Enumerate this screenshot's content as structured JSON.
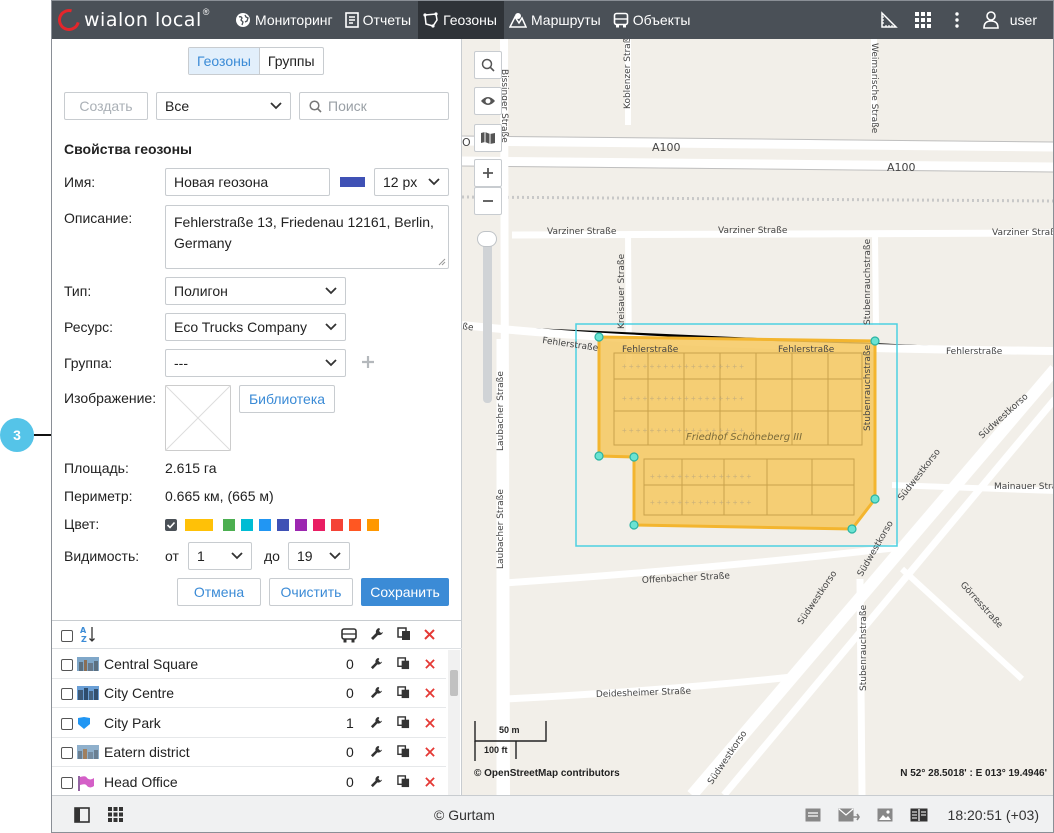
{
  "app": {
    "logo_text": "wialon local",
    "logo_sup": "®"
  },
  "nav": [
    {
      "label": "Мониторинг",
      "icon": "globe-icon"
    },
    {
      "label": "Отчеты",
      "icon": "report-icon"
    },
    {
      "label": "Геозоны",
      "icon": "geofence-icon",
      "active": true
    },
    {
      "label": "Маршруты",
      "icon": "route-icon"
    },
    {
      "label": "Объекты",
      "icon": "bus-icon"
    }
  ],
  "user": {
    "name": "user"
  },
  "tabs": {
    "geofences": "Геозоны",
    "groups": "Группы"
  },
  "toolbar": {
    "create": "Создать",
    "filter": "Все",
    "search_placeholder": "Поиск"
  },
  "props": {
    "section": "Свойства геозоны",
    "name_label": "Имя:",
    "name_value": "Новая геозона",
    "line_width": "12 px",
    "line_color": "#3f51b5",
    "description_label": "Описание:",
    "description_value": "Fehlerstraße 13, Friedenau 12161, Berlin, Germany",
    "type_label": "Тип:",
    "type_value": "Полигон",
    "resource_label": "Ресурс:",
    "resource_value": "Eco Trucks Company",
    "group_label": "Группа:",
    "group_value": "---",
    "image_label": "Изображение:",
    "library_button": "Библиотека",
    "area_label": "Площадь:",
    "area_value": "2.615 га",
    "perimeter_label": "Периметр:",
    "perimeter_value": "0.665 км, (665 м)",
    "color_label": "Цвет:",
    "colors": [
      "#ffc107",
      "#4caf50",
      "#00bcd4",
      "#2196f3",
      "#3f51b5",
      "#9c27b0",
      "#e91e63",
      "#f44336",
      "#ff5722",
      "#ff9800"
    ],
    "visibility_label": "Видимость:",
    "from_label": "от",
    "from_value": "1",
    "to_label": "до",
    "to_value": "19"
  },
  "actions": {
    "cancel": "Отмена",
    "clear": "Очистить",
    "save": "Сохранить"
  },
  "geofence_list": [
    {
      "name": "Central Square",
      "count": "0"
    },
    {
      "name": "City Centre",
      "count": "0"
    },
    {
      "name": "City Park",
      "count": "1"
    },
    {
      "name": "Eatern district",
      "count": "0"
    },
    {
      "name": "Head Office",
      "count": "0"
    }
  ],
  "map": {
    "streets": {
      "a100_1": "A100",
      "a100_2": "A100",
      "varziner_1": "Varziner Straße",
      "varziner_2": "Varziner Straße",
      "varziner_3": "Varziner Straße",
      "fehler_1": "Fehlerstraße",
      "fehler_2": "Fehlerstraße",
      "fehler_3": "Fehlerstraße",
      "fehler_4": "Fehlerstraße",
      "kreisauer": "Kreisauer Straße",
      "stubenrauch_1": "Stubenrauchstraße",
      "stubenrauch_2": "Stubenrauchstraße",
      "stubenrauch_3": "Stubenrauchstraße",
      "laubacher_1": "Laubacher Straße",
      "laubacher_2": "Laubacher Straße",
      "bissinger": "Bissinger Straße",
      "koblenzer": "Koblenzer Straße",
      "weimarische": "Weimarische Straße",
      "friedhof": "Friedhof Schöneberg III",
      "suedwest_1": "Südwestkorso",
      "suedwest_2": "Südwestkorso",
      "suedwest_3": "Südwestkorso",
      "suedwest_4": "Südwestkorso",
      "suedwest_5": "Südwestkorso",
      "mainauer": "Mainauer Straße",
      "offenbacher": "Offenbacher Straße",
      "goerres": "Görresstraße",
      "deidesheimer": "Deidesheimer Straße",
      "edge_o": "O"
    },
    "scale_m": "50 m",
    "scale_ft": "100 ft",
    "attribution": "© OpenStreetMap contributors",
    "coords": "N 52° 28.5018' : E 013° 19.4946'"
  },
  "footer": {
    "copyright": "© Gurtam",
    "time": "18:20:51 (+03)"
  },
  "callout": {
    "number": "3"
  }
}
